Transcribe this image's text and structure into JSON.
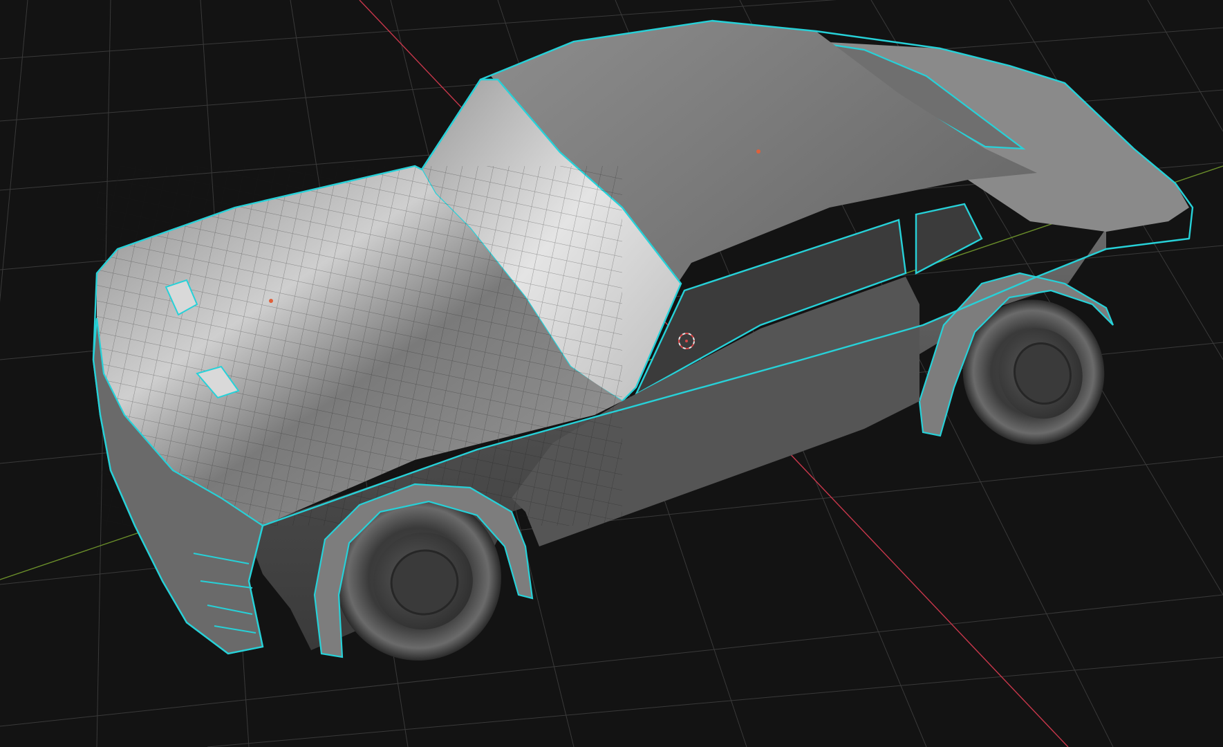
{
  "viewport": {
    "mode": "edit-mode-3d-viewport",
    "background_color": "#131313",
    "grid_color": "#3a3a3a",
    "x_axis_color": "#c8374b",
    "y_axis_color": "#6b8f2a"
  },
  "object": {
    "kind": "car-mesh",
    "body_color": "#6e6e6e",
    "selection_outline_color": "#27d1d8",
    "wire_color": "#1a1a1a",
    "glass_color": "#3b3b3b",
    "tire_color": "#2e2e2e"
  },
  "cursor": {
    "icon": "3d-cursor-icon",
    "ring_color": "#e8e8e8",
    "accent_color": "#d9484a"
  },
  "origin_points_color": "#e0603a"
}
